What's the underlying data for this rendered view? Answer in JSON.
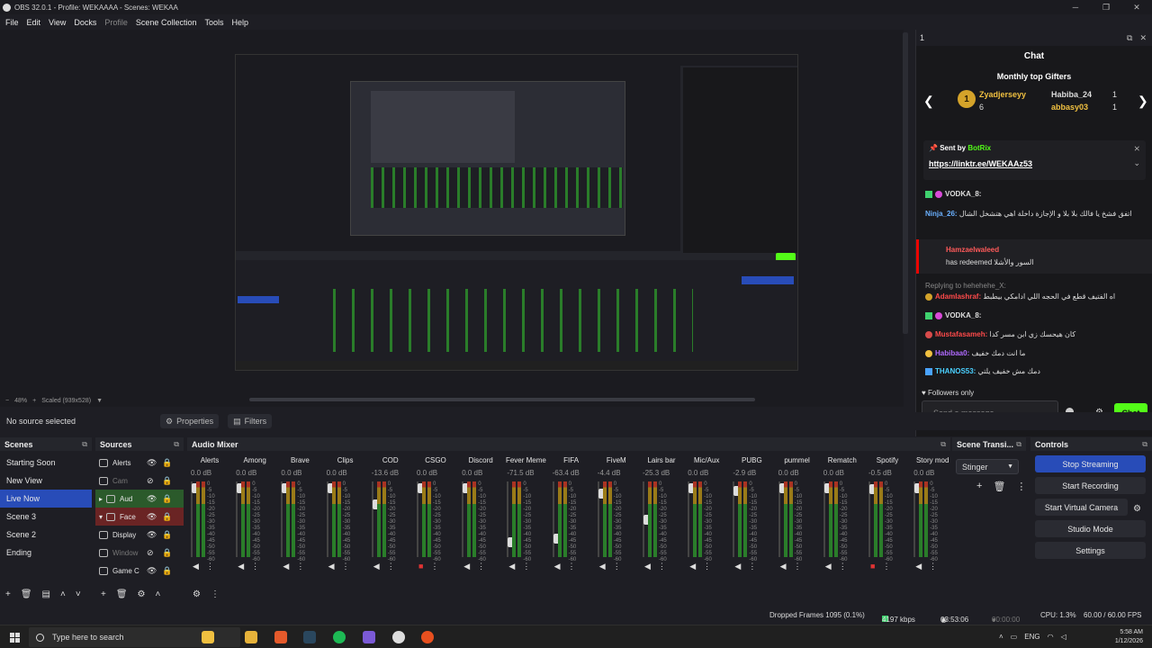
{
  "window": {
    "title": "OBS 32.0.1 - Profile: WEKAAAA - Scenes: WEKAA"
  },
  "menu": [
    "File",
    "Edit",
    "View",
    "Docks",
    "Profile",
    "Scene Collection",
    "Tools",
    "Help"
  ],
  "preview": {
    "zoom": "48%",
    "scaled": "Scaled (939x528)"
  },
  "chat_dock": {
    "number": "1",
    "title": "Chat",
    "gifters_title": "Monthly top Gifters",
    "gifters": [
      {
        "rank": "1",
        "name": "Zyadjerseyy",
        "count": "6"
      },
      {
        "name": "Habiba_24",
        "count": "1"
      },
      {
        "name": "abbasy03",
        "count": "1"
      }
    ],
    "pinned": {
      "sent_by": "Sent by",
      "bot": "BotRix",
      "link": "https://linktr.ee/WEKAAz53"
    },
    "messages": [
      {
        "user": "VODKA_8:",
        "text": ""
      },
      {
        "user": "Ninja_26:",
        "text": "اتفق فشخ يا فالك بلا بلا و الإجازة داخلة اهي هتشخل الشال"
      },
      {
        "user": "Hamzaelwaleed",
        "text": "has redeemed السور والأشلا"
      },
      {
        "user": "AdamIashraf:",
        "text": "اه الفتيف قطع في الحجه اللي ادامكي بيطبط"
      },
      {
        "user": "VODKA_8:",
        "text": ""
      },
      {
        "user": "Mustafasameh:",
        "text": "كان هيحسك زي ابن مسر كدا"
      },
      {
        "user": "Habibaa0:",
        "text": "ما انت دمك خفيف"
      },
      {
        "user": "THANOS53:",
        "text": "دمك مش خفيف يلتي"
      }
    ],
    "replying_to": "Replying to hehehehe_X:",
    "followers_only": "Followers only",
    "input_placeholder": "Send a message",
    "chat_button": "Chat"
  },
  "source_toolbar": {
    "no_source": "No source selected",
    "properties": "Properties",
    "filters": "Filters"
  },
  "scenes": {
    "title": "Scenes",
    "items": [
      "Starting Soon",
      "New View",
      "Live Now",
      "Scene 3",
      "Scene 2",
      "Ending"
    ],
    "active": "Live Now"
  },
  "sources": {
    "title": "Sources",
    "items": [
      "Alerts",
      "Cam",
      "Aud",
      "Face",
      "Display",
      "Window",
      "Game C"
    ]
  },
  "mixer": {
    "title": "Audio Mixer",
    "channels": [
      {
        "name": "Alerts",
        "db": "0.0 dB",
        "level": 0.92,
        "muted": false
      },
      {
        "name": "Among",
        "db": "0.0 dB",
        "level": 0.92,
        "muted": false
      },
      {
        "name": "Brave",
        "db": "0.0 dB",
        "level": 0.92,
        "muted": false
      },
      {
        "name": "Clips",
        "db": "0.0 dB",
        "level": 0.92,
        "muted": false
      },
      {
        "name": "COD",
        "db": "-13.6 dB",
        "level": 0.7,
        "muted": false
      },
      {
        "name": "CSGO",
        "db": "0.0 dB",
        "level": 0.92,
        "muted": true
      },
      {
        "name": "Discord",
        "db": "0.0 dB",
        "level": 0.92,
        "muted": false
      },
      {
        "name": "Fever Meme",
        "db": "-71.5 dB",
        "level": 0.2,
        "muted": false
      },
      {
        "name": "FIFA",
        "db": "-63.4 dB",
        "level": 0.25,
        "muted": false
      },
      {
        "name": "FiveM",
        "db": "-4.4 dB",
        "level": 0.85,
        "muted": false
      },
      {
        "name": "Lairs bar",
        "db": "-25.3 dB",
        "level": 0.5,
        "muted": false
      },
      {
        "name": "Mic/Aux",
        "db": "0.0 dB",
        "level": 0.92,
        "muted": false
      },
      {
        "name": "PUBG",
        "db": "-2.9 dB",
        "level": 0.88,
        "muted": false
      },
      {
        "name": "pummel",
        "db": "0.0 dB",
        "level": 0.92,
        "muted": false
      },
      {
        "name": "Rematch",
        "db": "0.0 dB",
        "level": 0.92,
        "muted": false
      },
      {
        "name": "Spotify",
        "db": "-0.5 dB",
        "level": 0.91,
        "muted": true
      },
      {
        "name": "Story mod",
        "db": "0.0 dB",
        "level": 0.92,
        "muted": false
      }
    ],
    "scale": [
      "0",
      "-5",
      "-10",
      "-15",
      "-20",
      "-25",
      "-30",
      "-35",
      "-40",
      "-45",
      "-50",
      "-55",
      "-60"
    ]
  },
  "transitions": {
    "title": "Scene Transi...",
    "selected": "Stinger"
  },
  "controls": {
    "title": "Controls",
    "buttons": [
      "Stop Streaming",
      "Start Recording",
      "Start Virtual Camera",
      "Studio Mode",
      "Settings"
    ]
  },
  "status": {
    "dropped": "Dropped Frames 1095 (0.1%)",
    "kbps": "4197 kbps",
    "stream_time": "03:53:06",
    "rec_time": "00:00:00",
    "cpu": "CPU: 1.3%",
    "fps": "60.00 / 60.00 FPS"
  },
  "taskbar": {
    "search_placeholder": "Type here to search",
    "lang": "ENG",
    "time": "5:58 AM",
    "date": "1/12/2026"
  },
  "colors": {
    "accent": "#284cb8",
    "kick_green": "#53fc18",
    "meter_green": "#2a7d2a"
  }
}
